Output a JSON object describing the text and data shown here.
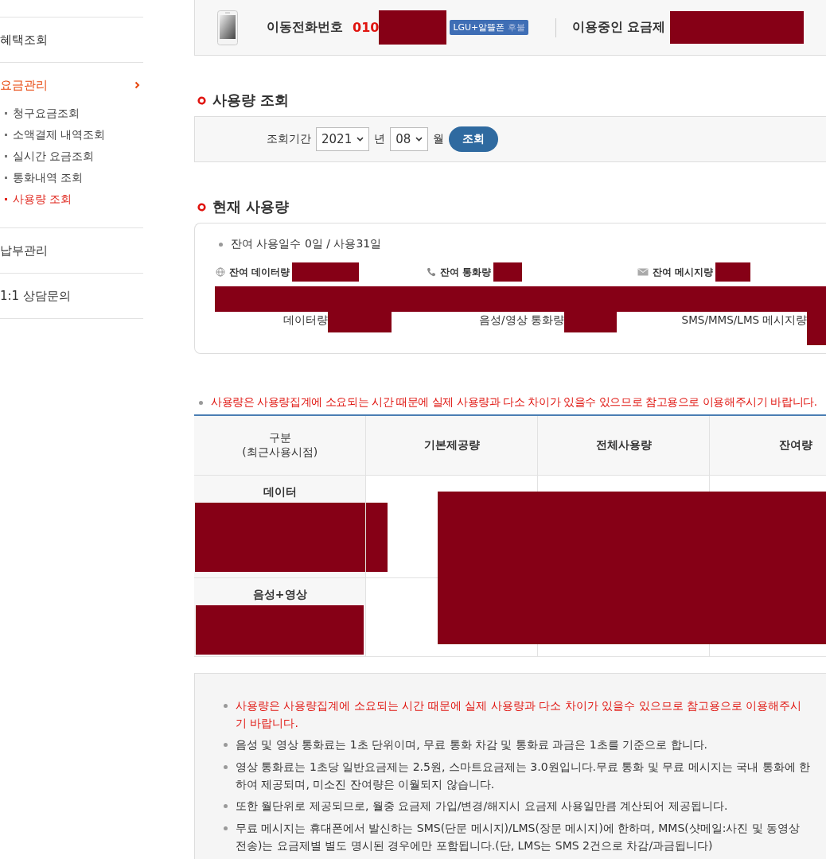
{
  "sidebar": {
    "items": [
      {
        "label": "혜택조회",
        "selected": false,
        "expanded": false
      },
      {
        "label": "요금관리",
        "selected": true,
        "expanded": true,
        "children": [
          {
            "label": "청구요금조회",
            "selected": false
          },
          {
            "label": "소액결제 내역조회",
            "selected": false
          },
          {
            "label": "실시간 요금조회",
            "selected": false
          },
          {
            "label": "통화내역 조회",
            "selected": false
          },
          {
            "label": "사용량 조회",
            "selected": true
          }
        ]
      },
      {
        "label": "납부관리",
        "selected": false,
        "expanded": false
      },
      {
        "label": "1:1 상담문의",
        "selected": false,
        "expanded": false
      }
    ]
  },
  "line_info": {
    "phone_label": "이동전화번호",
    "phone_prefix": "010",
    "carrier_badge": "LGU+알뜰폰",
    "badge_suffix": "후불",
    "plan_label": "이용중인 요금제"
  },
  "usage_query": {
    "title": "사용량 조회",
    "period_label": "조회기간",
    "year": "2021",
    "year_unit": "년",
    "month": "08",
    "month_unit": "월",
    "button": "조회"
  },
  "current_usage": {
    "title": "현재 사용량",
    "days": "잔여 사용일수 0일 / 사용31일",
    "remaining": [
      {
        "kind": "data",
        "label": "잔여 데이터량"
      },
      {
        "kind": "call",
        "label": "잔여 통화량"
      },
      {
        "kind": "message",
        "label": "잔여 메시지량"
      }
    ],
    "totals": [
      "데이터량",
      "음성/영상 통화량",
      "SMS/MMS/LMS 메시지량"
    ]
  },
  "notice": "사용량은 사용량집계에 소요되는 시간 때문에 실제 사용량과 다소 차이가 있을수 있으므로 참고용으로 이용해주시기 바랍니다.",
  "table": {
    "columns": [
      {
        "label": "구분",
        "sublabel": "(최근사용시점)"
      },
      {
        "label": "기본제공량"
      },
      {
        "label": "전체사용량"
      },
      {
        "label": "잔여량"
      }
    ],
    "rows": [
      {
        "label": "데이터"
      },
      {
        "label": "음성+영상"
      }
    ]
  },
  "notes": [
    {
      "text": "사용량은 사용량집계에 소요되는 시간 때문에 실제 사용량과 다소 차이가 있을수 있으므로 참고용으로 이용해주시기 바랍니다.",
      "highlight": true
    },
    {
      "text": "음성 및 영상 통화료는 1초 단위이며, 무료 통화 차감 및 통화료 과금은 1초를 기준으로 합니다.",
      "highlight": false
    },
    {
      "text": "영상 통화료는 1초당 일반요금제는 2.5원, 스마트요금제는 3.0원입니다.무료 통화 및 무료 메시지는 국내 통화에 한하여 제공되며, 미소진 잔여량은 이월되지 않습니다.",
      "highlight": false
    },
    {
      "text": "또한 월단위로 제공되므로, 월중 요금제 가입/변경/해지시 요금제 사용일만큼 계산되어 제공됩니다.",
      "highlight": false
    },
    {
      "text": "무료 메시지는 휴대폰에서 발신하는 SMS(단문 메시지)/LMS(장문 메시지)에 한하며, MMS(샷메일:사진 및 동영상 전송)는 요금제별 별도 명시된 경우에만 포함됩니다.(단, LMS는 SMS 2건으로 차감/과금됩니다)",
      "highlight": false
    }
  ]
}
